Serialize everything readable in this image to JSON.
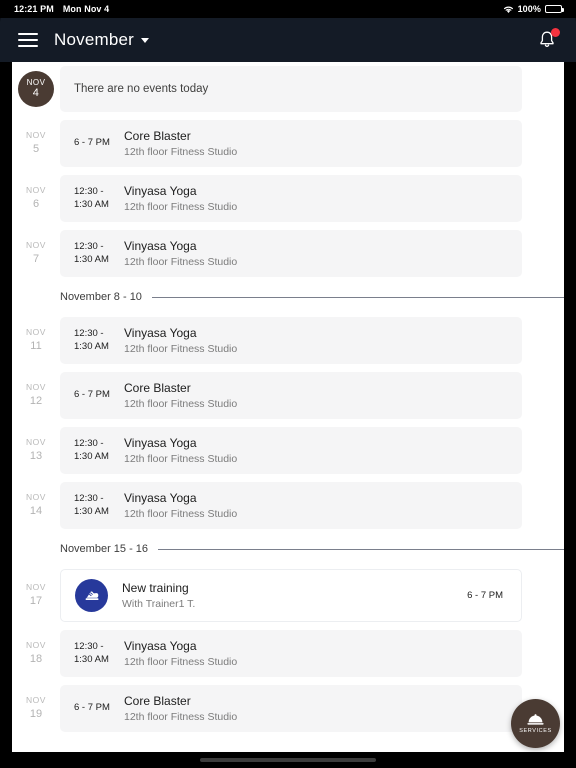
{
  "statusbar": {
    "time": "12:21 PM",
    "date": "Mon Nov 4",
    "battery_pct": "100%",
    "wifi_icon": "wifi-icon",
    "battery_icon": "battery-icon"
  },
  "appbar": {
    "menu_icon": "hamburger-menu-icon",
    "title": "November",
    "caret_icon": "chevron-down-icon",
    "bell_icon": "notification-bell-icon",
    "has_badge": true,
    "badge_color": "#f5333f",
    "background": "#141b26"
  },
  "theme": {
    "accent_brown": "#4a3b33",
    "card_bg": "#f5f5f6",
    "training_blue": "#27399b",
    "muted_text": "#b3b3b3"
  },
  "agenda": [
    {
      "kind": "event",
      "day_month": "NOV",
      "day_num": "4",
      "is_today": true,
      "empty_text": "There are no events today"
    },
    {
      "kind": "event",
      "day_month": "NOV",
      "day_num": "5",
      "time": "6 - 7 PM",
      "title": "Core Blaster",
      "subtitle": "12th floor Fitness Studio"
    },
    {
      "kind": "event",
      "day_month": "NOV",
      "day_num": "6",
      "time": "12:30 -\n1:30 AM",
      "title": "Vinyasa Yoga",
      "subtitle": "12th floor Fitness Studio"
    },
    {
      "kind": "event",
      "day_month": "NOV",
      "day_num": "7",
      "time": "12:30 -\n1:30 AM",
      "title": "Vinyasa Yoga",
      "subtitle": "12th floor Fitness Studio"
    },
    {
      "kind": "separator",
      "label": "November 8 - 10"
    },
    {
      "kind": "event",
      "day_month": "NOV",
      "day_num": "11",
      "time": "12:30 -\n1:30 AM",
      "title": "Vinyasa Yoga",
      "subtitle": "12th floor Fitness Studio"
    },
    {
      "kind": "event",
      "day_month": "NOV",
      "day_num": "12",
      "time": "6 - 7 PM",
      "title": "Core Blaster",
      "subtitle": "12th floor Fitness Studio"
    },
    {
      "kind": "event",
      "day_month": "NOV",
      "day_num": "13",
      "time": "12:30 -\n1:30 AM",
      "title": "Vinyasa Yoga",
      "subtitle": "12th floor Fitness Studio"
    },
    {
      "kind": "event",
      "day_month": "NOV",
      "day_num": "14",
      "time": "12:30 -\n1:30 AM",
      "title": "Vinyasa Yoga",
      "subtitle": "12th floor Fitness Studio"
    },
    {
      "kind": "separator",
      "label": "November 15 - 16"
    },
    {
      "kind": "training",
      "day_month": "NOV",
      "day_num": "17",
      "icon": "sneaker-icon",
      "title": "New training",
      "subtitle": "With Trainer1 T.",
      "time_right": "6 - 7 PM"
    },
    {
      "kind": "event",
      "day_month": "NOV",
      "day_num": "18",
      "time": "12:30 -\n1:30 AM",
      "title": "Vinyasa Yoga",
      "subtitle": "12th floor Fitness Studio"
    },
    {
      "kind": "event",
      "day_month": "NOV",
      "day_num": "19",
      "time": "6 - 7 PM",
      "title": "Core Blaster",
      "subtitle": "12th floor Fitness Studio"
    }
  ],
  "fab": {
    "icon": "service-bell-icon",
    "label": "SERVICES"
  }
}
